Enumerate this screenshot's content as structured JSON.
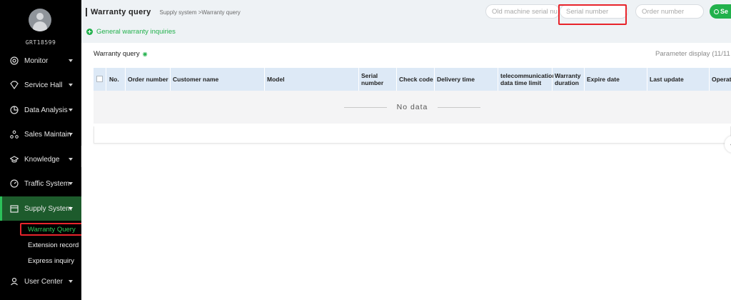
{
  "colors": {
    "accent": "#22b14c",
    "highlight": "#e8242b",
    "sidebar": "#000000",
    "table_header": "#dde9f6"
  },
  "user": {
    "name": "GRT18599"
  },
  "sidebar": {
    "items": [
      {
        "label": "Monitor",
        "icon": "monitor-icon"
      },
      {
        "label": "Service Hall",
        "icon": "diamond-icon"
      },
      {
        "label": "Data Analysis",
        "icon": "pie-chart-icon"
      },
      {
        "label": "Sales Maintain",
        "icon": "network-icon"
      },
      {
        "label": "Knowledge",
        "icon": "graduation-cap-icon"
      },
      {
        "label": "Traffic System",
        "icon": "gauge-icon"
      },
      {
        "label": "Supply System",
        "icon": "store-icon",
        "active": true
      },
      {
        "label": "User Center",
        "icon": "user-icon"
      }
    ],
    "sub_items": [
      {
        "label": "Warranty Query",
        "active": true
      },
      {
        "label": "Extension record"
      },
      {
        "label": "Express inquiry"
      }
    ]
  },
  "header": {
    "title": "Warranty query",
    "breadcrumb": "Supply system >Warranty query",
    "search": {
      "old_serial_placeholder": "Old machine serial nu",
      "serial_placeholder": "Serial number",
      "order_placeholder": "Order number",
      "button_label": "Se"
    },
    "general_link": "General warranty inquiries"
  },
  "panel": {
    "title": "Warranty query",
    "param_display": "Parameter display  (11/11"
  },
  "table": {
    "columns": [
      "No.",
      "Order number",
      "Customer name",
      "Model",
      "Serial number",
      "Check code",
      "Delivery time",
      "telecommunication data time limit",
      "Warranty duration",
      "Expire date",
      "Last update",
      "Operat"
    ],
    "empty_text": "No data"
  }
}
